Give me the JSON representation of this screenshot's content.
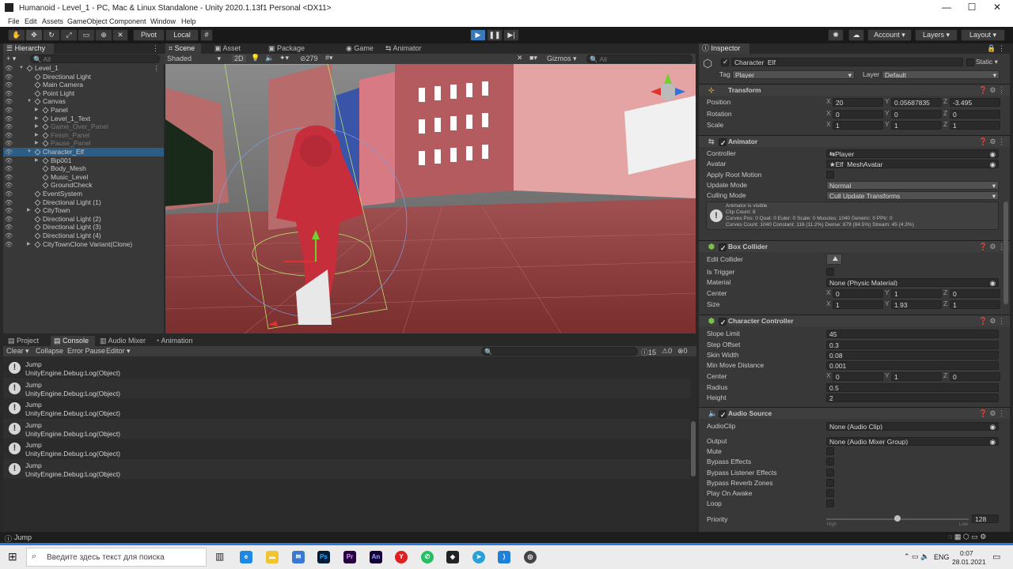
{
  "window": {
    "title": "Humanoid - Level_1 - PC, Mac & Linux Standalone - Unity 2020.1.13f1 Personal <DX11>"
  },
  "menu": [
    "File",
    "Edit",
    "Assets",
    "GameObject",
    "Component",
    "Window",
    "Help"
  ],
  "toolbar": {
    "pivot": "Pivot",
    "local": "Local",
    "account": "Account",
    "layers": "Layers",
    "layout": "Layout"
  },
  "hierarchy": {
    "tab": "Hierarchy",
    "add": "+ ▾",
    "search_placeholder": "All",
    "items": [
      {
        "label": "Level_1",
        "depth": 0,
        "expanded": true,
        "scene": true
      },
      {
        "label": "Directional Light",
        "depth": 1
      },
      {
        "label": "Main Camera",
        "depth": 1
      },
      {
        "label": "Point Light",
        "depth": 1
      },
      {
        "label": "Canvas",
        "depth": 1,
        "expanded": true
      },
      {
        "label": "Panel",
        "depth": 2,
        "collapsed": true
      },
      {
        "label": "Level_1_Text",
        "depth": 2,
        "collapsed": true
      },
      {
        "label": "Game_Over_Panel",
        "depth": 2,
        "collapsed": true,
        "inactive": true
      },
      {
        "label": "Finish_Panel",
        "depth": 2,
        "collapsed": true,
        "inactive": true
      },
      {
        "label": "Pause_Panel",
        "depth": 2,
        "collapsed": true,
        "inactive": true
      },
      {
        "label": "Character_Elf",
        "depth": 1,
        "expanded": true,
        "selected": true
      },
      {
        "label": "Bip001",
        "depth": 2,
        "collapsed": true
      },
      {
        "label": "Body_Mesh",
        "depth": 2
      },
      {
        "label": "Music_Level",
        "depth": 2
      },
      {
        "label": "GroundCheck",
        "depth": 2
      },
      {
        "label": "EventSystem",
        "depth": 1
      },
      {
        "label": "Directional Light (1)",
        "depth": 1
      },
      {
        "label": "CityTown",
        "depth": 1,
        "collapsed": true
      },
      {
        "label": "Directional Light (2)",
        "depth": 1
      },
      {
        "label": "Directional Light (3)",
        "depth": 1
      },
      {
        "label": "Directional Light (4)",
        "depth": 1
      },
      {
        "label": "CityTownClone Variant(Clone)",
        "depth": 1,
        "collapsed": true
      }
    ]
  },
  "scene": {
    "tabs": [
      "Scene",
      "Asset Store",
      "Package Manager",
      "Game",
      "Animator"
    ],
    "shading": "Shaded",
    "mode2d": "2D",
    "layer_count": "279",
    "gizmos": "Gizmos",
    "search_placeholder": "All"
  },
  "console": {
    "tabs": [
      "Project",
      "Console",
      "Audio Mixer",
      "Animation"
    ],
    "clear": "Clear",
    "collapse": "Collapse",
    "error_pause": "Error Pause",
    "editor": "Editor",
    "count_info": "15",
    "count_warn": "0",
    "count_error": "0",
    "entries": [
      {
        "msg": "Jump",
        "trace": "UnityEngine.Debug:Log(Object)"
      },
      {
        "msg": "Jump",
        "trace": "UnityEngine.Debug:Log(Object)"
      },
      {
        "msg": "Jump",
        "trace": "UnityEngine.Debug:Log(Object)"
      },
      {
        "msg": "Jump",
        "trace": "UnityEngine.Debug:Log(Object)"
      },
      {
        "msg": "Jump",
        "trace": "UnityEngine.Debug:Log(Object)"
      },
      {
        "msg": "Jump",
        "trace": "UnityEngine.Debug:Log(Object)"
      }
    ]
  },
  "inspector": {
    "tab": "Inspector",
    "object_name": "Character_Elf",
    "static": "Static",
    "tag_label": "Tag",
    "tag": "Player",
    "layer_label": "Layer",
    "layer": "Default",
    "transform": {
      "title": "Transform",
      "position": [
        "20",
        "0.05687835",
        "-3.495"
      ],
      "rotation": [
        "0",
        "0",
        "0"
      ],
      "scale": [
        "1",
        "1",
        "1"
      ]
    },
    "animator": {
      "title": "Animator",
      "controller": "Player",
      "avatar": "Elf_MeshAvatar",
      "update_mode": "Normal",
      "culling_mode": "Cull Update Transforms",
      "info": [
        "Animator is visible",
        "Clip Count: 8",
        "Curves Pos: 0 Quat: 0 Euler: 0 Scale: 0 Muscles: 1040 Generic: 0 PPtr: 0",
        "Curves Count: 1040 Constant: 116 (11.2%) Dense: 879 (84.5%) Stream: 45 (4.3%)"
      ]
    },
    "box_collider": {
      "title": "Box Collider",
      "material": "None (Physic Material)",
      "center": [
        "0",
        "1",
        "0"
      ],
      "size": [
        "1",
        "1.93",
        "1"
      ]
    },
    "character_controller": {
      "title": "Character Controller",
      "slope_limit": "45",
      "step_offset": "0.3",
      "skin_width": "0.08",
      "min_move_distance": "0.001",
      "center": [
        "0",
        "1",
        "0"
      ],
      "radius": "0.5",
      "height": "2"
    },
    "audio_source": {
      "title": "Audio Source",
      "audio_clip": "None (Audio Clip)",
      "output": "None (Audio Mixer Group)",
      "priority": "128",
      "high": "High",
      "low": "Low"
    },
    "labels": {
      "position": "Position",
      "rotation": "Rotation",
      "scale": "Scale",
      "controller": "Controller",
      "avatar": "Avatar",
      "apply_root_motion": "Apply Root Motion",
      "update_mode": "Update Mode",
      "culling_mode": "Culling Mode",
      "edit_collider": "Edit Collider",
      "is_trigger": "Is Trigger",
      "material": "Material",
      "center": "Center",
      "size": "Size",
      "slope_limit": "Slope Limit",
      "step_offset": "Step Offset",
      "skin_width": "Skin Width",
      "min_move_distance": "Min Move Distance",
      "radius": "Radius",
      "height": "Height",
      "audio_clip": "AudioClip",
      "output": "Output",
      "mute": "Mute",
      "bypass_effects": "Bypass Effects",
      "bypass_listener": "Bypass Listener Effects",
      "bypass_reverb": "Bypass Reverb Zones",
      "play_on_awake": "Play On Awake",
      "loop": "Loop",
      "priority": "Priority"
    }
  },
  "status": {
    "message": "Jump"
  },
  "taskbar": {
    "search_placeholder": "Введите здесь текст для поиска",
    "lang": "ENG",
    "time": "0:07",
    "date": "28.01.2021"
  }
}
